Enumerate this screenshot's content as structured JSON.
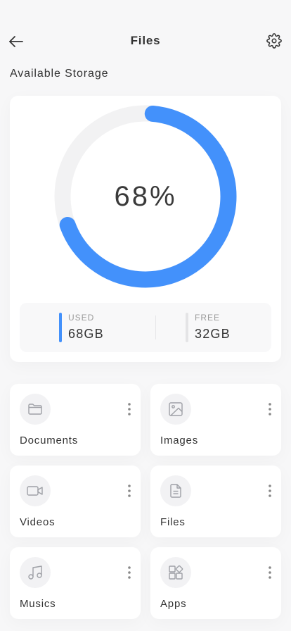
{
  "header": {
    "title": "Files",
    "back_icon": "arrow-left-icon",
    "settings_icon": "gear-icon"
  },
  "storage": {
    "section_title": "Available Storage",
    "percent_label": "68%",
    "percent_used": 68,
    "used": {
      "label": "USED",
      "value": "68GB",
      "color": "#4391fb"
    },
    "free": {
      "label": "FREE",
      "value": "32GB",
      "color": "#e4e4e6"
    },
    "ring_track_color": "#f2f2f3",
    "ring_fill_color": "#4391fb"
  },
  "categories": [
    {
      "label": "Documents",
      "icon": "folder-icon"
    },
    {
      "label": "Images",
      "icon": "image-icon"
    },
    {
      "label": "Videos",
      "icon": "video-camera-icon"
    },
    {
      "label": "Files",
      "icon": "file-icon"
    },
    {
      "label": "Musics",
      "icon": "music-note-icon"
    },
    {
      "label": "Apps",
      "icon": "apps-grid-icon"
    }
  ]
}
